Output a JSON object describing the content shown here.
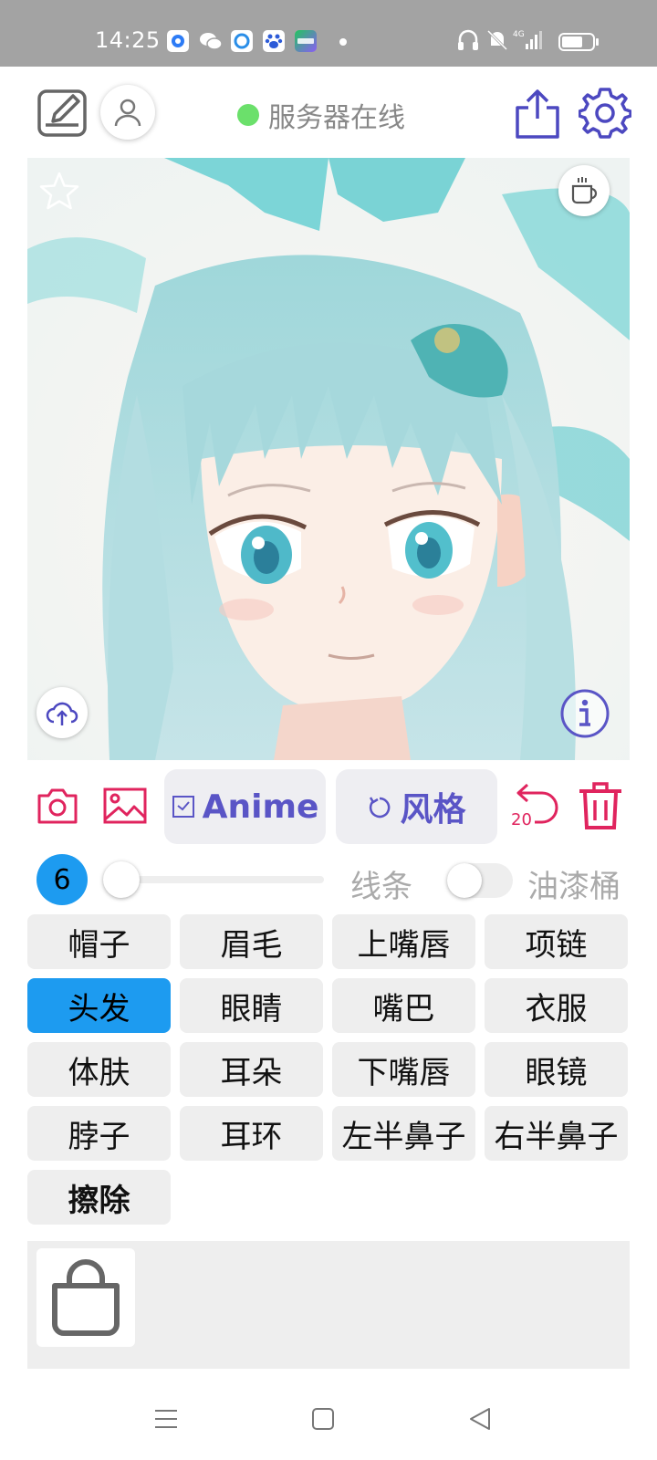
{
  "status_bar": {
    "time": "14:25",
    "app_icons": [
      "baidu-maps-icon",
      "wechat-icon",
      "browser-icon",
      "baidu-icon",
      "iqiyi-icon"
    ],
    "right_icons": [
      "headphones-icon",
      "mute-icon",
      "signal-4g-icon",
      "battery-icon"
    ]
  },
  "header": {
    "server_status": "服务器在线",
    "server_status_color": "#6be06b",
    "icons": [
      "edit-icon",
      "user-icon",
      "share-icon",
      "settings-icon"
    ]
  },
  "canvas": {
    "overlay_icons": [
      "star-icon",
      "coffee-icon",
      "upload-cloud-icon",
      "info-icon"
    ]
  },
  "toolbar": {
    "mode_label": "Anime",
    "style_label": "风格",
    "undo_count": "20",
    "accent_color": "#e0245e",
    "primary_color": "#5a55c6"
  },
  "brush": {
    "size": "6",
    "slider_value": 0,
    "line_label": "线条",
    "bucket_label": "油漆桶",
    "bucket_enabled": false
  },
  "parts": [
    {
      "label": "帽子",
      "active": false
    },
    {
      "label": "眉毛",
      "active": false
    },
    {
      "label": "上嘴唇",
      "active": false
    },
    {
      "label": "项链",
      "active": false
    },
    {
      "label": "头发",
      "active": true
    },
    {
      "label": "眼睛",
      "active": false
    },
    {
      "label": "嘴巴",
      "active": false
    },
    {
      "label": "衣服",
      "active": false
    },
    {
      "label": "体肤",
      "active": false
    },
    {
      "label": "耳朵",
      "active": false
    },
    {
      "label": "下嘴唇",
      "active": false
    },
    {
      "label": "眼镜",
      "active": false
    },
    {
      "label": "脖子",
      "active": false
    },
    {
      "label": "耳环",
      "active": false
    },
    {
      "label": "左半鼻子",
      "active": false
    },
    {
      "label": "右半鼻子",
      "active": false
    },
    {
      "label": "擦除",
      "active": false
    }
  ],
  "bottom_panel": {
    "icon": "shopping-bag-icon"
  },
  "nav_bar": [
    "menu-icon",
    "home-icon",
    "back-icon"
  ]
}
